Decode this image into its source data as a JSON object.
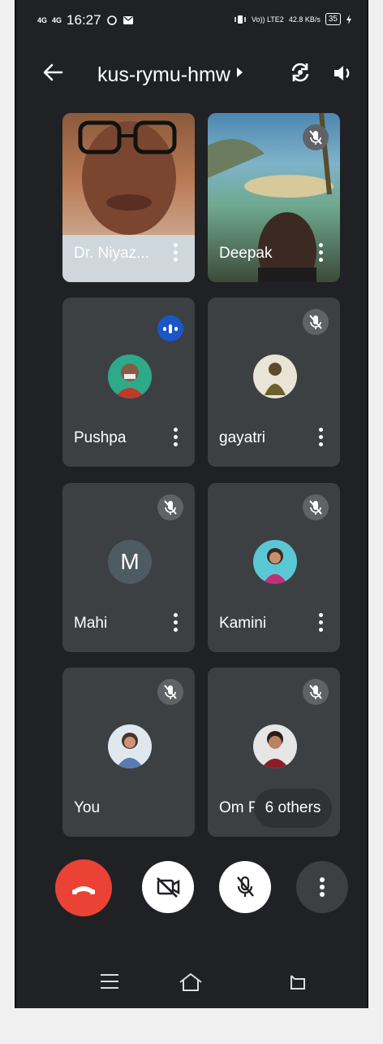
{
  "status_bar": {
    "network": "4G",
    "network2": "4G",
    "time": "16:27",
    "volte": "Vo)) LTE2",
    "speed": "42.8",
    "speed_unit": "KB/s",
    "battery": "35"
  },
  "top_bar": {
    "meeting_code": "kus-rymu-hmw",
    "back_icon": "arrow-left-icon",
    "switch_camera_icon": "camera-switch-icon",
    "speaker_icon": "speaker-icon"
  },
  "participants": [
    {
      "name": "Dr. Niyaz...",
      "type": "video",
      "muted": false
    },
    {
      "name": "Deepak",
      "type": "video",
      "muted": true
    },
    {
      "name": "Pushpa",
      "type": "avatar",
      "speaking": true
    },
    {
      "name": "gayatri",
      "type": "avatar",
      "muted": true
    },
    {
      "name": "Mahi",
      "type": "letter",
      "letter": "M",
      "muted": true
    },
    {
      "name": "Kamini",
      "type": "avatar",
      "muted": true
    },
    {
      "name": "You",
      "type": "avatar",
      "muted": true
    },
    {
      "name": "Om Prakash",
      "type": "avatar",
      "muted": true
    }
  ],
  "others_chip": "6 others",
  "controls": {
    "end_call_icon": "phone-hangup-icon",
    "camera_off_icon": "video-off-icon",
    "mic_off_icon": "mic-off-icon",
    "more_icon": "more-vert-icon"
  },
  "colors": {
    "background": "#202124",
    "tile": "#3c4043",
    "end_call": "#ea4335",
    "speaking": "#1a56c6"
  }
}
